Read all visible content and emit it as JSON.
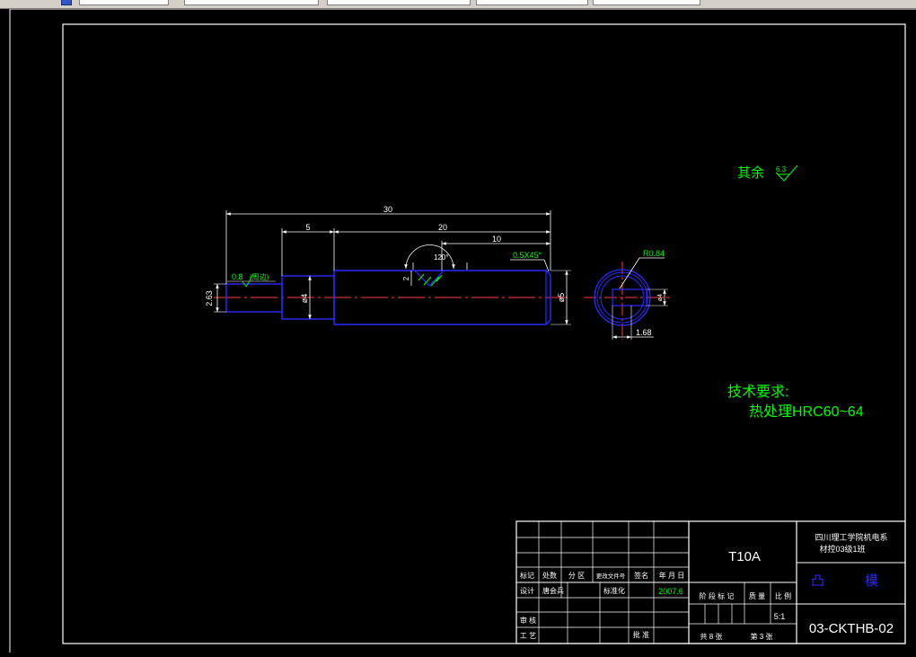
{
  "toolbar": {
    "dropdowns": [
      "",
      "",
      "",
      "",
      ""
    ]
  },
  "drawing": {
    "surface_note_label": "其余",
    "surface_note_value": "6.3",
    "tech_req_title": "技术要求:",
    "tech_req_item": "热处理HRC60~64",
    "dims": {
      "overall_length": "30",
      "step_length": "5",
      "body_length": "20",
      "slot_offset": "10",
      "chamfer": "0.5X45°",
      "roughness_note": "0.8",
      "roughness_note_suffix": "(周边)",
      "angle": "120°",
      "depth": "2",
      "tip_diameter": "2.63",
      "mid_diameter": "ø4",
      "main_diameter": "ø5",
      "radius": "R0.84",
      "section_width": "1.68",
      "section_height": "ø4"
    }
  },
  "title_block": {
    "material": "T10A",
    "school": "四川理工学院机电系",
    "class_name": "材控03级1班",
    "part_name_1": "凸",
    "part_name_2": "模",
    "drawing_no": "03-CKTHB-02",
    "col_marks": "标记",
    "col_count": "处数",
    "col_zone": "分 区",
    "col_docno": "更改文件号",
    "col_sign": "签名",
    "col_date": "年 月 日",
    "design_label": "设计",
    "designer": "唐会兵",
    "standard_label": "标准化",
    "date_value": "2007.6",
    "review_label": "审 核",
    "process_label": "工 艺",
    "approve_label": "批 准",
    "stage_label": "阶 段 标 记",
    "weight_label": "质 量",
    "scale_label": "比 例",
    "scale_value": "5:1",
    "sheets_total": "共 8 张",
    "sheet_no": "第 3 张"
  }
}
